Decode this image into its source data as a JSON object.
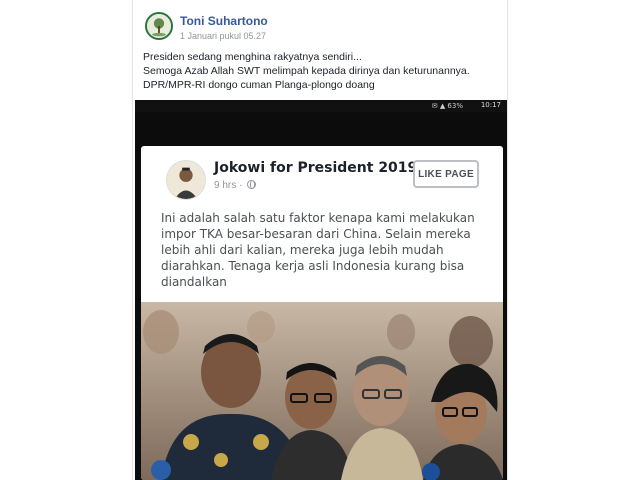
{
  "post": {
    "author": "Toni Suhartono",
    "timestamp": "1 Januari pukul 05.27",
    "caption_lines": [
      "Presiden sedang menghina rakyatnya sendiri...",
      "Semoga Azab Allah SWT melimpah kepada dirinya dan keturunannya.",
      "DPR/MPR-RI dongo cuman Planga-plongo doang"
    ]
  },
  "screenshot": {
    "status_time": "10:17",
    "status_icons": "✉ ▲ 63%",
    "card": {
      "page_name": "Jokowi for President 2019",
      "meta": "9 hrs · ",
      "like_button": "LIKE PAGE",
      "text_lines": [
        "Ini adalah salah satu faktor kenapa kami melakukan",
        "impor TKA besar-besaran dari China. Selain mereka",
        "lebih ahli dari kalian, mereka juga lebih mudah",
        "diarahkan. Tenaga kerja asli Indonesia kurang bisa",
        "diandalkan"
      ]
    }
  },
  "colors": {
    "author_link": "#385898",
    "meta_gray": "#90949c",
    "text_dark": "#1d2129"
  },
  "icons": [
    "profile-avatar-icon",
    "page-avatar-icon",
    "globe-icon"
  ]
}
